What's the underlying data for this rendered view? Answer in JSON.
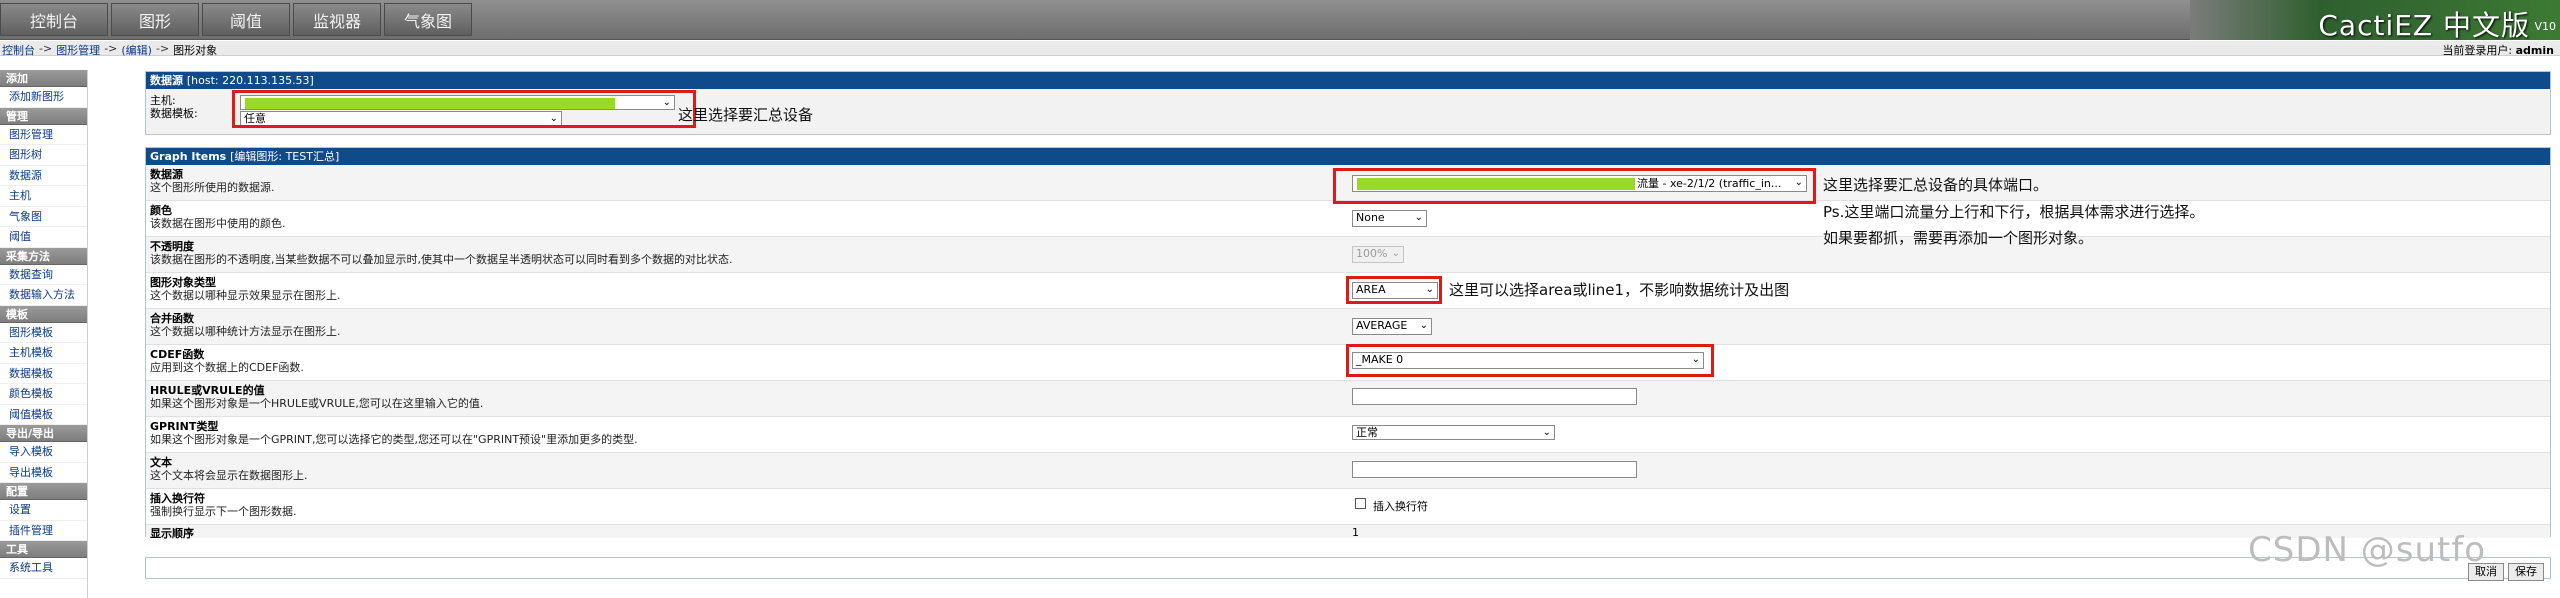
{
  "topnav": {
    "tabs": [
      "控制台",
      "图形",
      "阈值",
      "监视器",
      "气象图"
    ],
    "brand": "CactiEZ 中文版",
    "version": "V10"
  },
  "breadcrumb": {
    "items": [
      "控制台",
      "图形管理",
      "(编辑)",
      "图形对象"
    ],
    "separator": "->"
  },
  "user": {
    "label": "当前登录用户:",
    "name": "admin"
  },
  "sidebar": [
    {
      "header": "添加",
      "items": [
        "添加新图形"
      ]
    },
    {
      "header": "管理",
      "items": [
        "图形管理",
        "图形树",
        "数据源",
        "主机",
        "气象图",
        "阈值"
      ]
    },
    {
      "header": "采集方法",
      "items": [
        "数据查询",
        "数据输入方法"
      ]
    },
    {
      "header": "模板",
      "items": [
        "图形模板",
        "主机模板",
        "数据模板",
        "颜色模板",
        "阈值模板"
      ]
    },
    {
      "header": "导出/导出",
      "items": [
        "导入模板",
        "导出模板"
      ]
    },
    {
      "header": "配置",
      "items": [
        "设置",
        "插件管理"
      ]
    },
    {
      "header": "工具",
      "items": [
        "系统工具"
      ]
    }
  ],
  "datasource_panel": {
    "title": "数据源",
    "host_note": "[host: 220.113.135.53]",
    "host_label": "主机:",
    "template_label": "数据模板:",
    "template_value": "任意",
    "annotation": "这里选择要汇总设备"
  },
  "graph_items_panel": {
    "title": "Graph Items",
    "subtitle": "[编辑图形: TEST汇总]",
    "fields": {
      "datasource": {
        "title": "数据源",
        "desc": "这个图形所使用的数据源.",
        "value": "流量 - xe-2/1/2 (traffic_in..."
      },
      "color": {
        "title": "颜色",
        "desc": "该数据在图形中使用的颜色.",
        "value": "None"
      },
      "opacity": {
        "title": "不透明度",
        "desc": "该数据在图形的不透明度,当某些数据不可以叠加显示时,使其中一个数据呈半透明状态可以同时看到多个数据的对比状态.",
        "value": "100%"
      },
      "item_type": {
        "title": "图形对象类型",
        "desc": "这个数据以哪种显示效果显示在图形上.",
        "value": "AREA"
      },
      "consolidation": {
        "title": "合并函数",
        "desc": "这个数据以哪种统计方法显示在图形上.",
        "value": "AVERAGE"
      },
      "cdef": {
        "title": "CDEF函数",
        "desc": "应用到这个数据上的CDEF函数.",
        "value": "_MAKE 0"
      },
      "hrule": {
        "title": "HRULE或VRULE的值",
        "desc": "如果这个图形对象是一个HRULE或VRULE,您可以在这里输入它的值.",
        "value": ""
      },
      "gprint": {
        "title": "GPRINT类型",
        "desc": "如果这个图形对象是一个GPRINT,您可以选择它的类型,您还可以在\"GPRINT预设\"里添加更多的类型.",
        "value": "正常"
      },
      "text": {
        "title": "文本",
        "desc": "这个文本将会显示在数据图形上.",
        "value": ""
      },
      "hard_return": {
        "title": "插入换行符",
        "desc": "强制换行显示下一个图形数据.",
        "checkbox_label": "插入换行符"
      },
      "sequence": {
        "title": "显示顺序",
        "value": "1"
      }
    },
    "annotations": {
      "datasource_1": "这里选择要汇总设备的具体端口。",
      "datasource_2": "Ps.这里端口流量分上行和下行，根据具体需求进行选择。",
      "datasource_3": "如果要都抓，需要再添加一个图形对象。",
      "item_type": "这里可以选择area或line1，不影响数据统计及出图"
    }
  },
  "buttons": {
    "cancel": "取消",
    "save": "保存"
  },
  "watermark": "CSDN @sutfo",
  "colors": {
    "panel_header": "#0f4a8a",
    "highlight": "#e01919",
    "masked": "#99d92a"
  }
}
